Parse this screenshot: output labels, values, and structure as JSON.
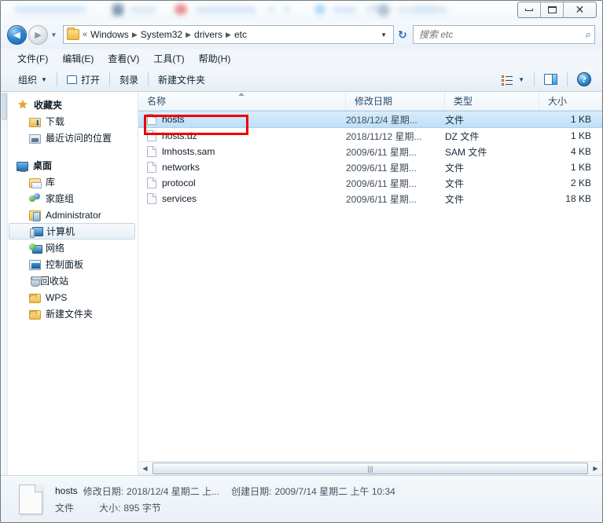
{
  "window": {
    "controls": {
      "minimize": "minimize",
      "maximize": "maximize",
      "close": "✕"
    }
  },
  "address_bar": {
    "back": "◀",
    "forward": "▶",
    "history_caret": "▼",
    "chevrons": "«",
    "crumbs": [
      "Windows",
      "System32",
      "drivers",
      "etc"
    ],
    "separator": "▶",
    "dropdown_caret": "▼",
    "refresh": "↻"
  },
  "search": {
    "placeholder": "搜索 etc",
    "value": "",
    "icon": "⌕"
  },
  "menubar": {
    "items": [
      {
        "label": "文件(F)"
      },
      {
        "label": "编辑(E)"
      },
      {
        "label": "查看(V)"
      },
      {
        "label": "工具(T)"
      },
      {
        "label": "帮助(H)"
      }
    ]
  },
  "toolbar": {
    "organize_label": "组织",
    "organize_caret": "▼",
    "open_label": "打开",
    "burn_label": "刻录",
    "newfolder_label": "新建文件夹",
    "view_caret": "▼",
    "help_label": "?"
  },
  "sidebar": {
    "items": [
      {
        "label": "收藏夹",
        "icon": "star-icon",
        "level": 0,
        "bold": true,
        "selected": false
      },
      {
        "label": "下载",
        "icon": "download-folder-icon",
        "level": 1,
        "bold": false,
        "selected": false
      },
      {
        "label": "最近访问的位置",
        "icon": "recent-places-icon",
        "level": 1,
        "bold": false,
        "selected": false
      },
      {
        "label": "桌面",
        "icon": "desktop-icon",
        "level": 0,
        "bold": true,
        "selected": false,
        "gap_before": true
      },
      {
        "label": "库",
        "icon": "library-icon",
        "level": 1,
        "bold": false,
        "selected": false
      },
      {
        "label": "家庭组",
        "icon": "homegroup-icon",
        "level": 1,
        "bold": false,
        "selected": false
      },
      {
        "label": "Administrator",
        "icon": "user-folder-icon",
        "level": 1,
        "bold": false,
        "selected": false
      },
      {
        "label": "计算机",
        "icon": "computer-icon",
        "level": 1,
        "bold": false,
        "selected": true
      },
      {
        "label": "网络",
        "icon": "network-icon",
        "level": 1,
        "bold": false,
        "selected": false
      },
      {
        "label": "控制面板",
        "icon": "control-panel-icon",
        "level": 1,
        "bold": false,
        "selected": false
      },
      {
        "label": "回收站",
        "icon": "recycle-bin-icon",
        "level": 1,
        "bold": false,
        "selected": false
      },
      {
        "label": "WPS",
        "icon": "folder-icon",
        "level": 1,
        "bold": false,
        "selected": false
      },
      {
        "label": "新建文件夹",
        "icon": "folder-icon",
        "level": 1,
        "bold": false,
        "selected": false
      }
    ]
  },
  "filelist": {
    "columns": [
      {
        "label": "名称",
        "sorted": "asc"
      },
      {
        "label": "修改日期",
        "sorted": ""
      },
      {
        "label": "类型",
        "sorted": ""
      },
      {
        "label": "大小",
        "sorted": ""
      }
    ],
    "rows": [
      {
        "name": "hosts",
        "date": "2018/12/4 星期...",
        "type": "文件",
        "size": "1 KB",
        "selected": true
      },
      {
        "name": "hosts.dz",
        "date": "2018/11/12 星期...",
        "type": "DZ 文件",
        "size": "1 KB",
        "selected": false
      },
      {
        "name": "lmhosts.sam",
        "date": "2009/6/11 星期...",
        "type": "SAM 文件",
        "size": "4 KB",
        "selected": false
      },
      {
        "name": "networks",
        "date": "2009/6/11 星期...",
        "type": "文件",
        "size": "1 KB",
        "selected": false
      },
      {
        "name": "protocol",
        "date": "2009/6/11 星期...",
        "type": "文件",
        "size": "2 KB",
        "selected": false
      },
      {
        "name": "services",
        "date": "2009/6/11 星期...",
        "type": "文件",
        "size": "18 KB",
        "selected": false
      }
    ],
    "annotation_color": "#ee0000",
    "hscroll": {
      "left_arrow": "◀",
      "right_arrow": "▶",
      "grip": "|||"
    }
  },
  "statusbar": {
    "filename": "hosts",
    "modified_key": "修改日期:",
    "modified_value": "2018/12/4 星期二 上...",
    "created_key": "创建日期:",
    "created_value": "2009/7/14 星期二 上午 10:34",
    "type_value": "文件",
    "size_key": "大小:",
    "size_value": "895 字节"
  }
}
